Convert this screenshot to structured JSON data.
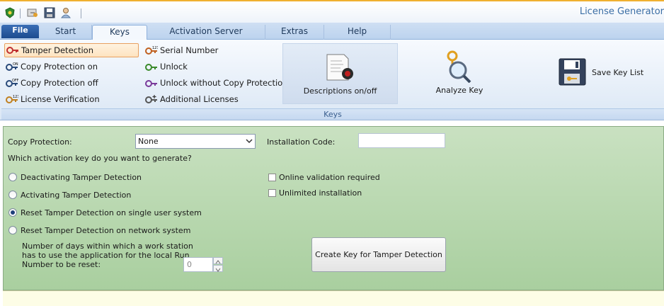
{
  "app": {
    "title": "License Generator"
  },
  "quick_access": [
    {
      "icon": "shield-icon"
    },
    {
      "icon": "key-edit-icon"
    },
    {
      "icon": "save-icon"
    },
    {
      "icon": "user-icon"
    }
  ],
  "tabs": [
    {
      "label": "File",
      "active": false
    },
    {
      "label": "Start",
      "active": false
    },
    {
      "label": "Keys",
      "active": true
    },
    {
      "label": "Activation Server",
      "active": false
    },
    {
      "label": "Extras",
      "active": false
    },
    {
      "label": "Help",
      "active": false
    }
  ],
  "ribbon": {
    "left_items": [
      {
        "label": "Tamper Detection",
        "icon": "tamper-key-icon"
      },
      {
        "label": "Copy Protection on",
        "icon": "copy-on-key-icon"
      },
      {
        "label": "Copy Protection off",
        "icon": "copy-off-key-icon"
      },
      {
        "label": "License Verification",
        "icon": "verify-key-icon"
      }
    ],
    "mid_items": [
      {
        "label": "Serial Number",
        "icon": "serial-key-icon"
      },
      {
        "label": "Unlock",
        "icon": "unlock-key-icon"
      },
      {
        "label": "Unlock without Copy Protection",
        "icon": "unlock-nocopy-key-icon"
      },
      {
        "label": "Additional Licenses",
        "icon": "additional-key-icon"
      }
    ],
    "descriptions_label": "Descriptions on/off",
    "analyze_label": "Analyze Key",
    "save_label": "Save Key List",
    "group_label": "Keys"
  },
  "form": {
    "copy_protection_label": "Copy Protection:",
    "copy_protection_value": "None",
    "installation_code_label": "Installation Code:",
    "installation_code_value": "",
    "question": "Which activation key do you want to generate?",
    "radios": [
      {
        "label": "Deactivating Tamper Detection",
        "checked": false
      },
      {
        "label": "Activating Tamper Detection",
        "checked": false
      },
      {
        "label": "Reset Tamper Detection on single user system",
        "checked": true
      },
      {
        "label": "Reset Tamper Detection on network system",
        "checked": false
      }
    ],
    "checkboxes": [
      {
        "label": "Online validation required",
        "checked": false
      },
      {
        "label": "Unlimited installation",
        "checked": false
      }
    ],
    "days_label_1": "Number of days within which a work station",
    "days_label_2": "has to use the application for the local Run",
    "days_label_3": "Number to be reset:",
    "days_value": "0",
    "create_button": "Create Key for Tamper Detection"
  }
}
